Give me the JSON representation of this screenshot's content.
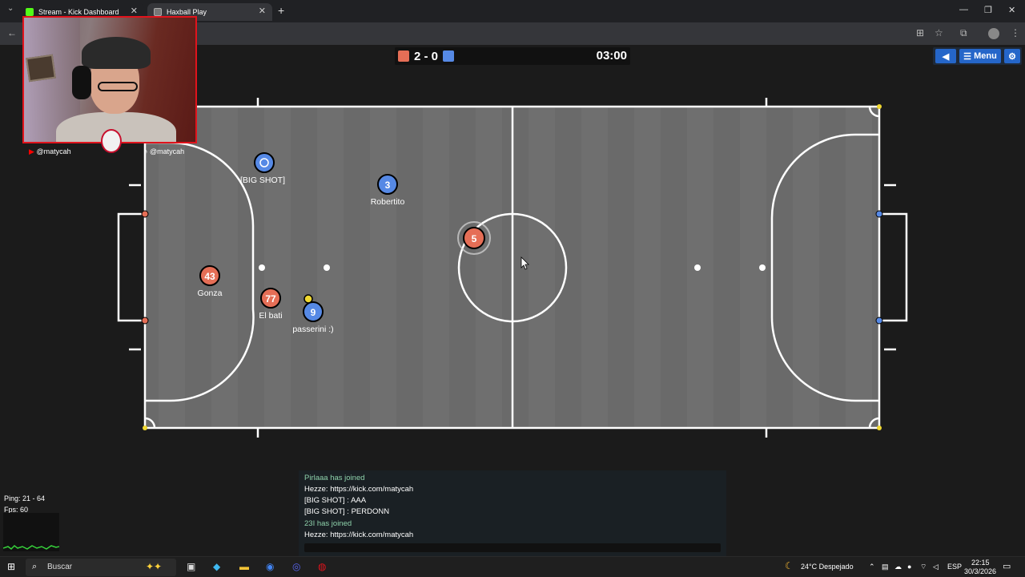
{
  "browser": {
    "tabs": [
      {
        "title": "Stream - Kick Dashboard",
        "color": "#53fc18"
      },
      {
        "title": "Haxball Play",
        "color": "#888888"
      }
    ]
  },
  "game": {
    "score": "2 - 0",
    "timer": "03:00",
    "red_color": "#e56e56",
    "blue_color": "#5689e5",
    "menu_label": "Menu",
    "players": [
      {
        "number": "3",
        "name": "Robertito",
        "team": "blue"
      },
      {
        "number": "5",
        "name": "",
        "team": "red"
      },
      {
        "number": "43",
        "name": "Gonza",
        "team": "red"
      },
      {
        "number": "77",
        "name": "El bati",
        "team": "red"
      },
      {
        "number": "9",
        "name": "passerini :)",
        "team": "blue"
      },
      {
        "number": "",
        "name": "[BIG SHOT]",
        "team": "blue"
      }
    ]
  },
  "overlay": {
    "youtube_handle": "@matycah",
    "tiktok_handle": "@matycah"
  },
  "chat": {
    "lines": [
      {
        "text": "Pirlaaa has joined",
        "type": "join"
      },
      {
        "text": "Hezze: https://kick.com/matycah",
        "type": "msg"
      },
      {
        "text": "[BIG SHOT] : AAA",
        "type": "msg"
      },
      {
        "text": "[BIG SHOT] : PERDONN",
        "type": "msg"
      },
      {
        "text": "23I has joined",
        "type": "join"
      },
      {
        "text": "Hezze: https://kick.com/matycah",
        "type": "msg"
      }
    ]
  },
  "stats": {
    "ping": "Ping: 21 - 64",
    "fps": "Fps: 60"
  },
  "taskbar": {
    "search_placeholder": "Buscar",
    "weather": "24°C  Despejado",
    "lang": "ESP",
    "time": "22:15",
    "date": "30/3/2026"
  }
}
